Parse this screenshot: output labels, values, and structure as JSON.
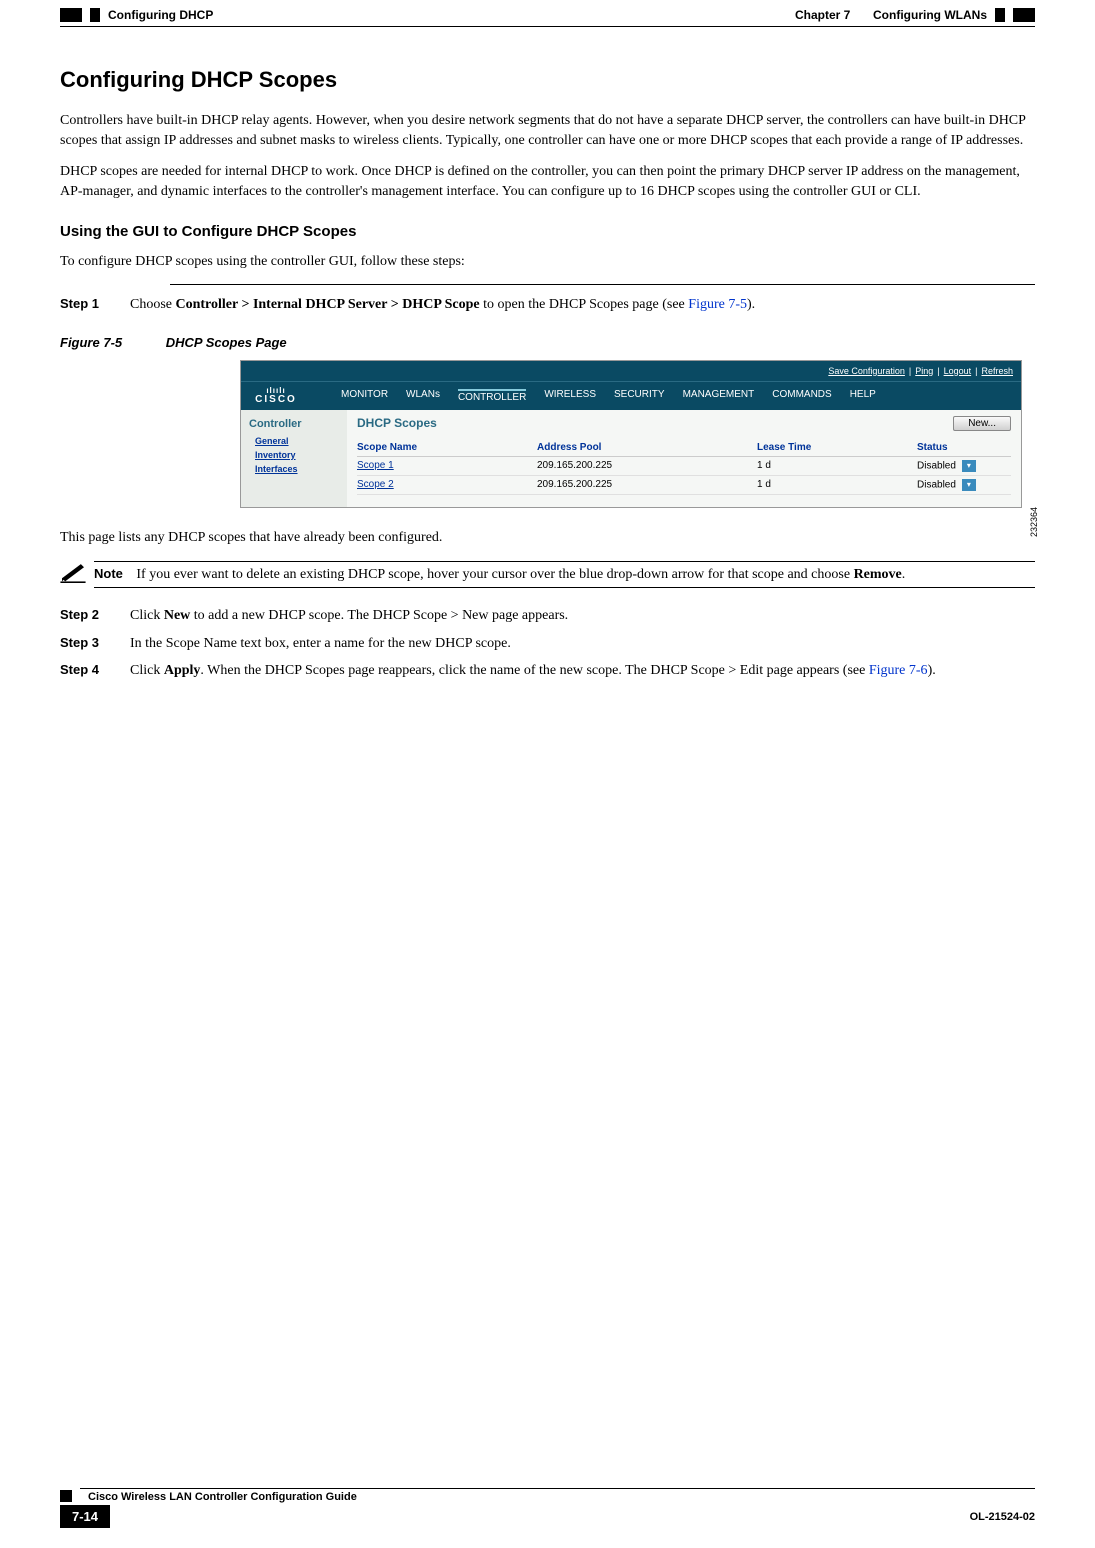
{
  "header": {
    "chapter": "Chapter 7",
    "chapter_title": "Configuring WLANs",
    "section_crumb": "Configuring DHCP"
  },
  "h2": "Configuring DHCP Scopes",
  "para1": "Controllers have built-in DHCP relay agents. However, when you desire network segments that do not have a separate DHCP server, the controllers can have built-in DHCP scopes that assign IP addresses and subnet masks to wireless clients. Typically, one controller can have one or more DHCP scopes that each provide a range of IP addresses.",
  "para2": "DHCP scopes are needed for internal DHCP to work. Once DHCP is defined on the controller, you can then point the primary DHCP server IP address on the management, AP-manager, and dynamic interfaces to the controller's management interface. You can configure up to 16 DHCP scopes using the controller GUI or CLI.",
  "h3": "Using the GUI to Configure DHCP Scopes",
  "para3": "To configure DHCP scopes using the controller GUI, follow these steps:",
  "steps": {
    "s1_label": "Step 1",
    "s1_pre": "Choose ",
    "s1_bold": "Controller > Internal DHCP Server > DHCP Scope",
    "s1_mid": " to open the DHCP Scopes page (see ",
    "s1_link": "Figure 7-5",
    "s1_end": ").",
    "s2_label": "Step 2",
    "s2_pre": "Click ",
    "s2_bold": "New",
    "s2_post": " to add a new DHCP scope. The DHCP Scope > New page appears.",
    "s3_label": "Step 3",
    "s3_text": "In the Scope Name text box, enter a name for the new DHCP scope.",
    "s4_label": "Step 4",
    "s4_pre": "Click ",
    "s4_bold": "Apply",
    "s4_mid": ". When the DHCP Scopes page reappears, click the name of the new scope. The DHCP Scope > Edit page appears (see ",
    "s4_link": "Figure 7-6",
    "s4_end": ")."
  },
  "figure": {
    "num": "Figure 7-5",
    "title": "DHCP Scopes Page",
    "image_id": "232364"
  },
  "screenshot": {
    "topbar": {
      "save": "Save Configuration",
      "ping": "Ping",
      "logout": "Logout",
      "refresh": "Refresh"
    },
    "logo_top": "ılıılı",
    "logo_bottom": "CISCO",
    "menu": [
      "MONITOR",
      "WLANs",
      "CONTROLLER",
      "WIRELESS",
      "SECURITY",
      "MANAGEMENT",
      "COMMANDS",
      "HELP"
    ],
    "sidebar": {
      "title": "Controller",
      "items": [
        "General",
        "Inventory",
        "Interfaces"
      ]
    },
    "page_title": "DHCP Scopes",
    "new_button": "New...",
    "columns": {
      "name": "Scope Name",
      "pool": "Address Pool",
      "lease": "Lease Time",
      "status": "Status"
    },
    "rows": [
      {
        "name": "Scope 1",
        "pool": "209.165.200.225",
        "lease": "1 d",
        "status": "Disabled"
      },
      {
        "name": "Scope 2",
        "pool": "209.165.200.225",
        "lease": "1 d",
        "status": "Disabled"
      }
    ]
  },
  "after_fig": "This page lists any DHCP scopes that have already been configured.",
  "note": {
    "label": "Note",
    "pre": "If you ever want to delete an existing DHCP scope, hover your cursor over the blue drop-down arrow for that scope and choose ",
    "bold": "Remove",
    "end": "."
  },
  "footer": {
    "guide": "Cisco Wireless LAN Controller Configuration Guide",
    "pagenum": "7-14",
    "docnum": "OL-21524-02"
  }
}
